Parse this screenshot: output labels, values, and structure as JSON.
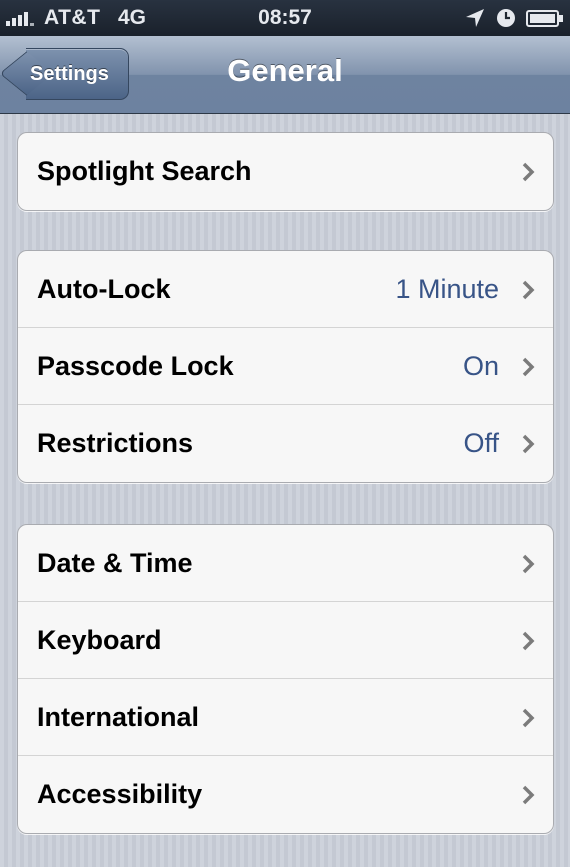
{
  "status_bar": {
    "carrier": "AT&T",
    "network": "4G",
    "time": "08:57",
    "icons": [
      "signal-icon",
      "location-icon",
      "clock-icon",
      "battery-icon"
    ]
  },
  "nav": {
    "back_label": "Settings",
    "title": "General"
  },
  "groups": [
    [
      {
        "label": "Spotlight Search",
        "value": ""
      }
    ],
    [
      {
        "label": "Auto-Lock",
        "value": "1 Minute"
      },
      {
        "label": "Passcode Lock",
        "value": "On"
      },
      {
        "label": "Restrictions",
        "value": "Off"
      }
    ],
    [
      {
        "label": "Date & Time",
        "value": ""
      },
      {
        "label": "Keyboard",
        "value": ""
      },
      {
        "label": "International",
        "value": ""
      },
      {
        "label": "Accessibility",
        "value": ""
      }
    ]
  ],
  "colors": {
    "value_text": "#385487",
    "nav_bar": "#6e83a0",
    "background": "#c9ced8"
  }
}
